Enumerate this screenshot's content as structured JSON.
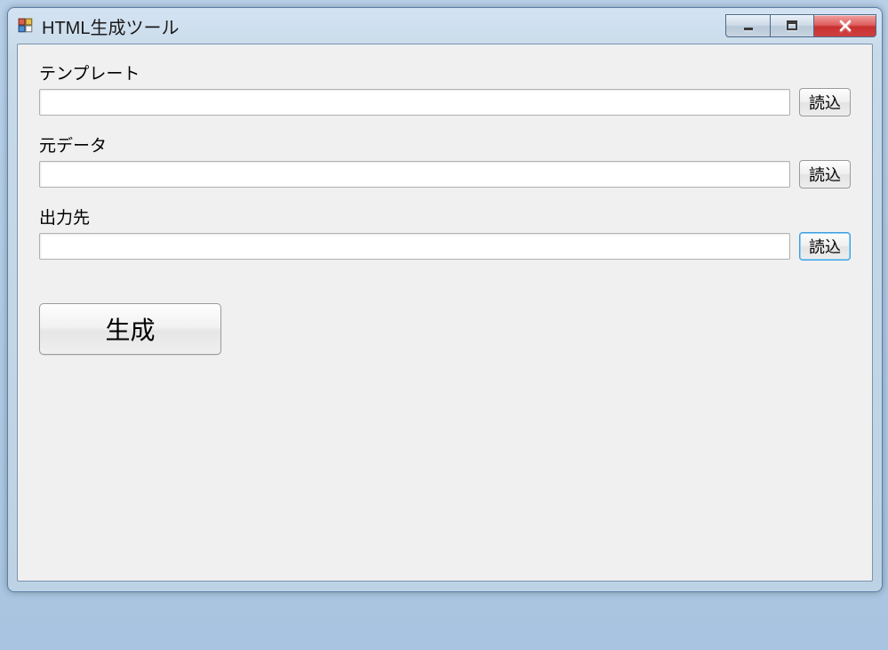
{
  "window": {
    "title": "HTML生成ツール"
  },
  "fields": {
    "template": {
      "label": "テンプレート",
      "value": "",
      "button": "読込"
    },
    "source": {
      "label": "元データ",
      "value": "",
      "button": "読込"
    },
    "output": {
      "label": "出力先",
      "value": "",
      "button": "読込"
    }
  },
  "actions": {
    "generate": "生成"
  }
}
